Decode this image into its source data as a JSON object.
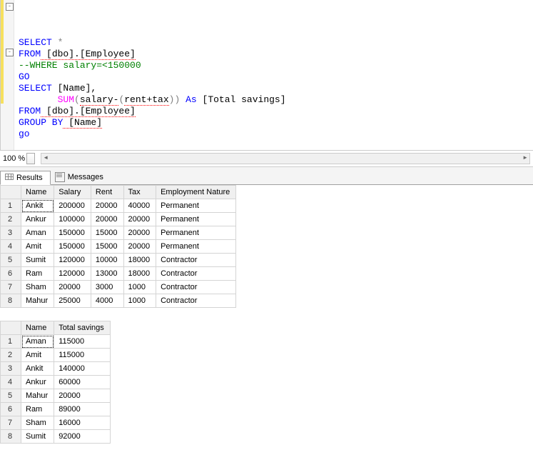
{
  "editor": {
    "line1_select": "SELECT",
    "line1_star": " *",
    "line2_from": "FROM",
    "line2_obj": " [dbo].[Employee]",
    "line3_comment": "--WHERE salary=<150000",
    "line4_go": "GO",
    "line5_select": "SELECT",
    "line5_rest": " [Name],",
    "line6_indent": "       ",
    "line6_sum": "SUM",
    "line6_open": "(",
    "line6_expr": "salary-",
    "line6_open2": "(",
    "line6_expr2": "rent+tax",
    "line6_close2": ")",
    "line6_close": ")",
    "line6_as": " As ",
    "line6_alias": "[Total savings]",
    "line7_from": "FROM",
    "line7_obj": " [dbo].[Employee]",
    "line8_group": "GROUP BY",
    "line8_col": " [Name]",
    "line9_go": "go"
  },
  "zoom": {
    "label": "100 %"
  },
  "tabs": {
    "results": "Results",
    "messages": "Messages"
  },
  "grid1": {
    "headers": [
      "",
      "Name",
      "Salary",
      "Rent",
      "Tax",
      "Employment Nature"
    ],
    "rows": [
      [
        "1",
        "Ankit",
        "200000",
        "20000",
        "40000",
        "Permanent"
      ],
      [
        "2",
        "Ankur",
        "100000",
        "20000",
        "20000",
        "Permanent"
      ],
      [
        "3",
        "Aman",
        "150000",
        "15000",
        "20000",
        "Permanent"
      ],
      [
        "4",
        "Amit",
        "150000",
        "15000",
        "20000",
        "Permanent"
      ],
      [
        "5",
        "Sumit",
        "120000",
        "10000",
        "18000",
        "Contractor"
      ],
      [
        "6",
        "Ram",
        "120000",
        "13000",
        "18000",
        "Contractor"
      ],
      [
        "7",
        "Sham",
        "20000",
        "3000",
        "1000",
        "Contractor"
      ],
      [
        "8",
        "Mahur",
        "25000",
        "4000",
        "1000",
        "Contractor"
      ]
    ]
  },
  "grid2": {
    "headers": [
      "",
      "Name",
      "Total savings"
    ],
    "rows": [
      [
        "1",
        "Aman",
        "115000"
      ],
      [
        "2",
        "Amit",
        "115000"
      ],
      [
        "3",
        "Ankit",
        "140000"
      ],
      [
        "4",
        "Ankur",
        "60000"
      ],
      [
        "5",
        "Mahur",
        "20000"
      ],
      [
        "6",
        "Ram",
        "89000"
      ],
      [
        "7",
        "Sham",
        "16000"
      ],
      [
        "8",
        "Sumit",
        "92000"
      ]
    ]
  }
}
